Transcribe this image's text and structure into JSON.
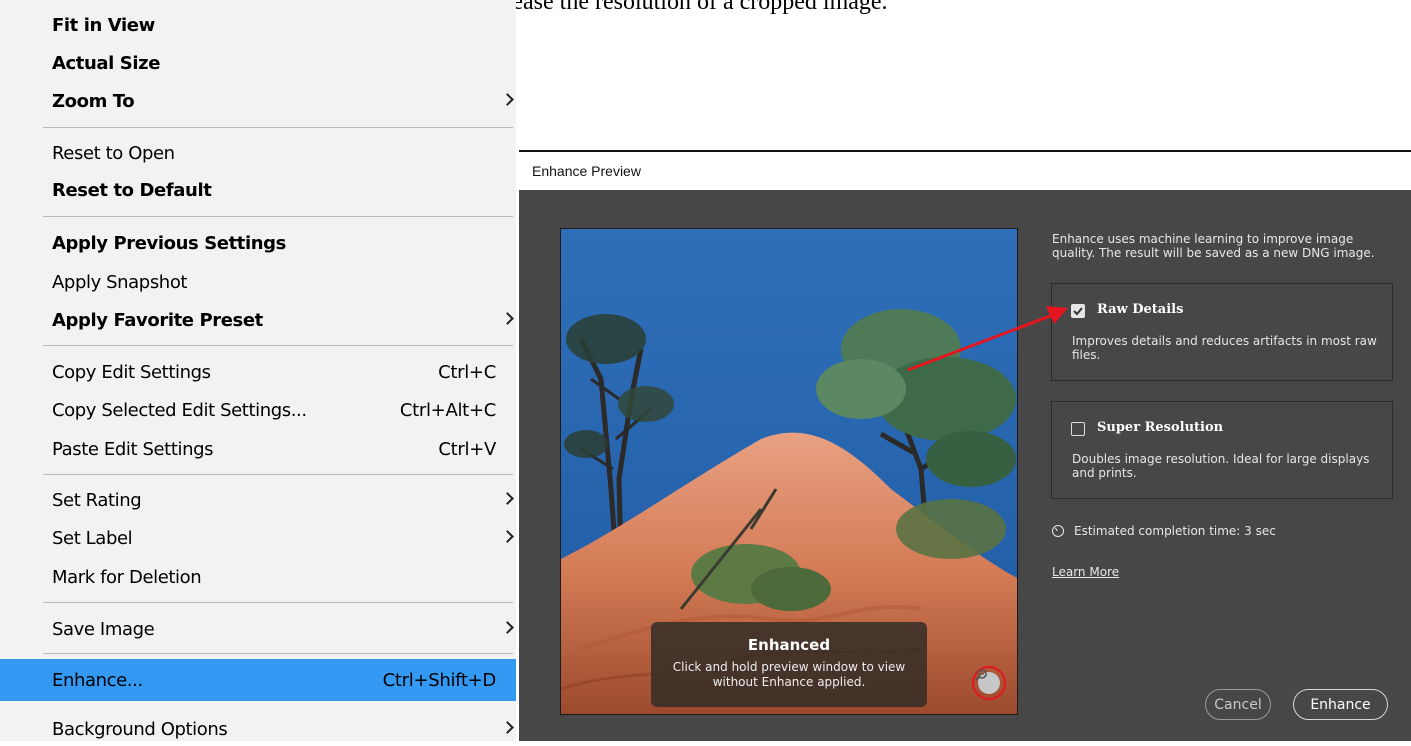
{
  "doc_text": "TIP : Super Resolution is especially useful to increase the resolution of a cropped image.",
  "menu": {
    "items": [
      {
        "label": "Fit in View",
        "bold": true
      },
      {
        "label": "Actual Size",
        "bold": true
      },
      {
        "label": "Zoom To",
        "bold": true,
        "submenu": true
      },
      {
        "label": "Reset to Open",
        "bold": false
      },
      {
        "label": "Reset to Default",
        "bold": true
      },
      {
        "label": "Apply Previous Settings",
        "bold": true
      },
      {
        "label": "Apply Snapshot",
        "bold": false
      },
      {
        "label": "Apply Favorite Preset",
        "bold": true,
        "submenu": true
      },
      {
        "label": "Copy Edit Settings",
        "bold": false,
        "shortcut": "Ctrl+C"
      },
      {
        "label": "Copy Selected Edit Settings...",
        "bold": false,
        "shortcut": "Ctrl+Alt+C"
      },
      {
        "label": "Paste Edit Settings",
        "bold": false,
        "shortcut": "Ctrl+V"
      },
      {
        "label": "Set Rating",
        "bold": false,
        "submenu": true
      },
      {
        "label": "Set Label",
        "bold": false,
        "submenu": true
      },
      {
        "label": "Mark for Deletion",
        "bold": false
      },
      {
        "label": "Save Image",
        "bold": false,
        "submenu": true
      },
      {
        "label": "Enhance...",
        "bold": false,
        "shortcut": "Ctrl+Shift+D",
        "highlighted": true
      },
      {
        "label": "Background Options",
        "bold": false,
        "submenu": true
      }
    ],
    "highlight_color": "#3399f3"
  },
  "dialog": {
    "title": "Enhance Preview",
    "description": "Enhance uses machine learning to improve image quality. The result will be saved as a new DNG image.",
    "preview_overlay": {
      "title": "Enhanced",
      "text": "Click and hold preview window to view without Enhance applied."
    },
    "options": [
      {
        "title": "Raw Details",
        "checked": true,
        "description": "Improves details and reduces artifacts in most raw files."
      },
      {
        "title": "Super Resolution",
        "checked": false,
        "description": "Doubles image resolution. Ideal for large displays and prints."
      }
    ],
    "estimate": "Estimated completion time: 3 sec",
    "learn_more": "Learn More",
    "cancel_label": "Cancel",
    "enhance_label": "Enhance"
  },
  "annotation_color": "#e4151e",
  "icons": [
    "chevron-right-icon",
    "checkbox-checked-icon",
    "checkbox-empty-icon",
    "timer-icon",
    "zoom-magnifier-icon"
  ]
}
